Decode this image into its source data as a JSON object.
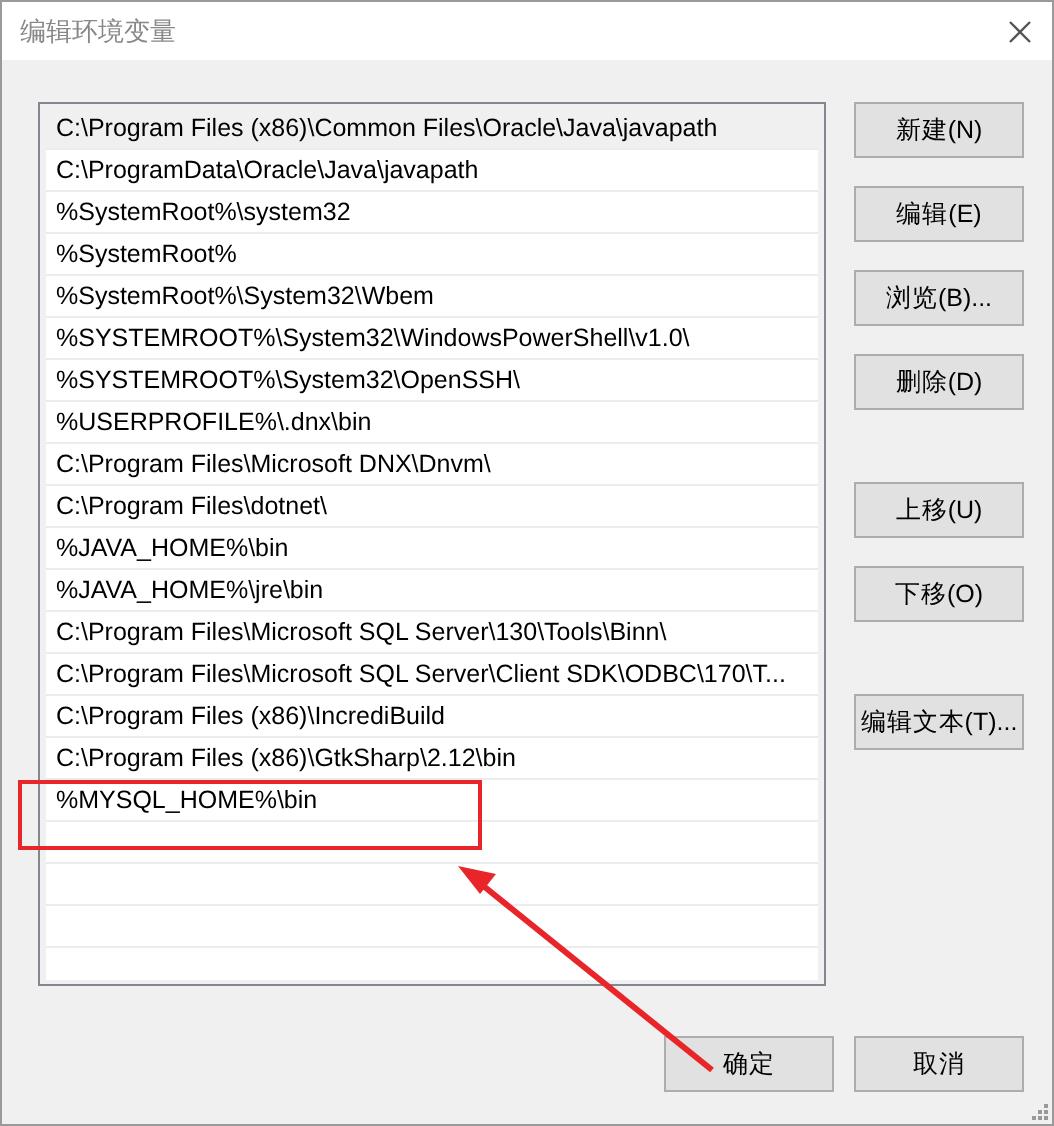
{
  "window": {
    "title": "编辑环境变量"
  },
  "paths": [
    {
      "text": "C:\\Program Files (x86)\\Common Files\\Oracle\\Java\\javapath",
      "selected": true
    },
    {
      "text": "C:\\ProgramData\\Oracle\\Java\\javapath",
      "selected": false
    },
    {
      "text": "%SystemRoot%\\system32",
      "selected": false
    },
    {
      "text": "%SystemRoot%",
      "selected": false
    },
    {
      "text": "%SystemRoot%\\System32\\Wbem",
      "selected": false
    },
    {
      "text": "%SYSTEMROOT%\\System32\\WindowsPowerShell\\v1.0\\",
      "selected": false
    },
    {
      "text": "%SYSTEMROOT%\\System32\\OpenSSH\\",
      "selected": false
    },
    {
      "text": "%USERPROFILE%\\.dnx\\bin",
      "selected": false
    },
    {
      "text": "C:\\Program Files\\Microsoft DNX\\Dnvm\\",
      "selected": false
    },
    {
      "text": "C:\\Program Files\\dotnet\\",
      "selected": false
    },
    {
      "text": "%JAVA_HOME%\\bin",
      "selected": false
    },
    {
      "text": "%JAVA_HOME%\\jre\\bin",
      "selected": false
    },
    {
      "text": "C:\\Program Files\\Microsoft SQL Server\\130\\Tools\\Binn\\",
      "selected": false
    },
    {
      "text": "C:\\Program Files\\Microsoft SQL Server\\Client SDK\\ODBC\\170\\T...",
      "selected": false
    },
    {
      "text": "C:\\Program Files (x86)\\IncrediBuild",
      "selected": false
    },
    {
      "text": "C:\\Program Files (x86)\\GtkSharp\\2.12\\bin",
      "selected": false
    },
    {
      "text": "%MYSQL_HOME%\\bin",
      "selected": false
    }
  ],
  "side_button_groups": [
    [
      "新建(N)",
      "编辑(E)",
      "浏览(B)...",
      "删除(D)"
    ],
    [
      "上移(U)",
      "下移(O)"
    ],
    [
      "编辑文本(T)..."
    ]
  ],
  "footer_buttons": [
    "确定",
    "取消"
  ]
}
